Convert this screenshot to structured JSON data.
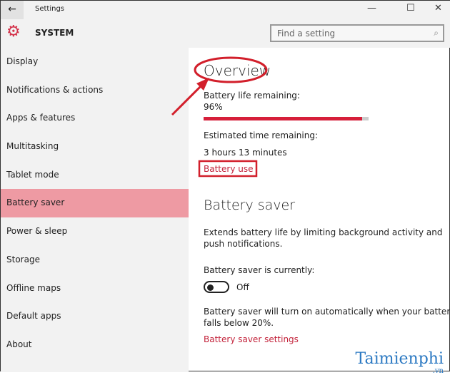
{
  "window": {
    "title": "Settings",
    "back_icon": "arrow-left-icon",
    "minimize_icon": "minimize-icon",
    "maximize_icon": "maximize-icon",
    "close_icon": "close-icon"
  },
  "header": {
    "section": "SYSTEM",
    "icon": "gear-icon",
    "icon_color": "#d4324a",
    "search_placeholder": "Find a setting"
  },
  "sidebar": {
    "selected": "Battery saver",
    "selected_color": "#ee9aa3",
    "items": [
      {
        "label": "Display"
      },
      {
        "label": "Notifications & actions"
      },
      {
        "label": "Apps & features"
      },
      {
        "label": "Multitasking"
      },
      {
        "label": "Tablet mode"
      },
      {
        "label": "Battery saver"
      },
      {
        "label": "Power & sleep"
      },
      {
        "label": "Storage"
      },
      {
        "label": "Offline maps"
      },
      {
        "label": "Default apps"
      },
      {
        "label": "About"
      }
    ]
  },
  "main": {
    "overview_title": "Overview",
    "battery_life_label": "Battery life remaining:",
    "battery_life_value": "96%",
    "battery_percent": 96,
    "estimated_label": "Estimated time remaining:",
    "estimated_value": "3 hours 13 minutes",
    "battery_use_link": "Battery use",
    "saver_title": "Battery saver",
    "saver_desc_line1": "Extends battery life by limiting background activity and",
    "saver_desc_line2": "push notifications.",
    "saver_status_label": "Battery saver is currently:",
    "saver_toggle_state": "Off",
    "auto_line1": "Battery saver will turn on automatically when your battery",
    "auto_line2": "falls below 20%.",
    "saver_settings_link": "Battery saver settings",
    "accent_color": "#c3223a"
  },
  "watermark": {
    "text": "Taimienphi",
    "suffix": ".vn"
  }
}
